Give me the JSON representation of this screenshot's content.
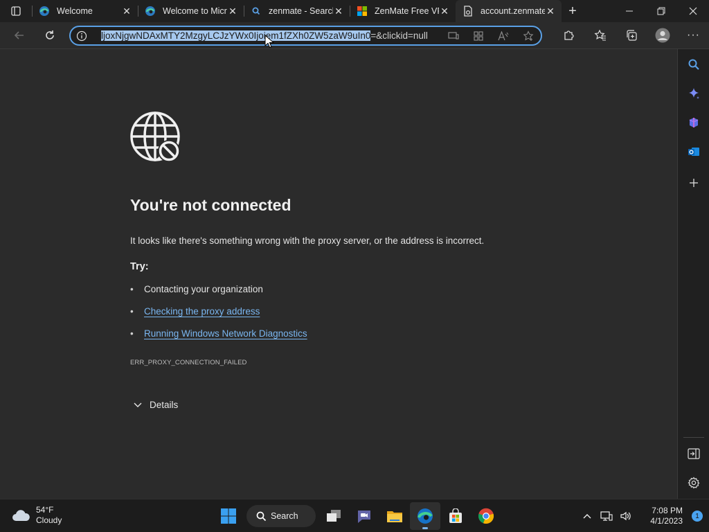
{
  "tabs": [
    {
      "title": "Welcome",
      "icon": "edge-icon",
      "active": false
    },
    {
      "title": "Welcome to Microsoft Edge",
      "icon": "edge-icon",
      "active": false
    },
    {
      "title": "zenmate - Search",
      "icon": "search-icon",
      "active": false
    },
    {
      "title": "ZenMate Free VPN",
      "icon": "microsoft-store-icon",
      "active": false
    },
    {
      "title": "account.zenmate.com",
      "icon": "page-error-icon",
      "active": true
    }
  ],
  "address_bar": {
    "selected_text": "ljoxNjgwNDAxMTY2MzgyLCJzYWx0Ijoiem1fZXh0ZW5zaW9uIn0",
    "rest_text": "=&clickid=null"
  },
  "error_page": {
    "title": "You're not connected",
    "description": "It looks like there's something wrong with the proxy server, or the address is incorrect.",
    "try_label": "Try:",
    "suggestions": [
      {
        "text": "Contacting your organization",
        "link": false
      },
      {
        "text": "Checking the proxy address",
        "link": true
      },
      {
        "text": "Running Windows Network Diagnostics",
        "link": true
      }
    ],
    "error_code": "ERR_PROXY_CONNECTION_FAILED",
    "details_label": "Details"
  },
  "taskbar": {
    "weather_temp": "54°F",
    "weather_desc": "Cloudy",
    "search_label": "Search",
    "time": "7:08 PM",
    "date": "4/1/2023",
    "notification_count": "1"
  },
  "colors": {
    "accent": "#5aa0e6",
    "link": "#7ab6f0",
    "page_bg": "#2b2b2b"
  }
}
